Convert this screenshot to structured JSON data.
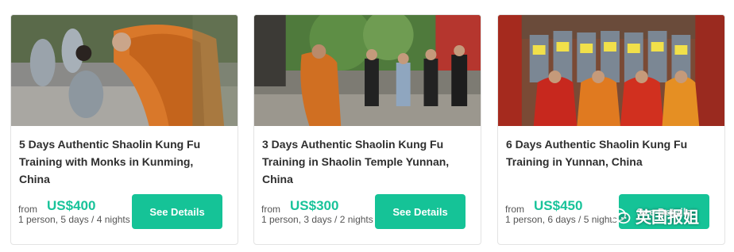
{
  "cards": [
    {
      "title": "5 Days Authentic Shaolin Kung Fu Training with Monks in Kunming, China",
      "from_label": "from",
      "price": "US$400",
      "meta": "1 person, 5 days / 4 nights",
      "button_label": "See Details",
      "image": "shaolin-monks-students-bowing-photo"
    },
    {
      "title": "3 Days Authentic Shaolin Kung Fu Training in Shaolin Temple Yunnan, China",
      "from_label": "from",
      "price": "US$300",
      "meta": "1 person, 3 days / 2 nights",
      "button_label": "See Details",
      "image": "kung-fu-group-training-courtyard-photo"
    },
    {
      "title": "6 Days Authentic Shaolin Kung Fu Training in Yunnan, China",
      "from_label": "from",
      "price": "US$450",
      "meta": "1 person, 6 days / 5 nights",
      "button_label": "See Details",
      "image": "group-photo-monks-certificates-photo"
    }
  ],
  "watermark": {
    "text": "英国报姐",
    "icon": "wechat-icon"
  },
  "colors": {
    "accent": "#15c397",
    "price": "#19c39a",
    "title": "#2f2f2f"
  }
}
